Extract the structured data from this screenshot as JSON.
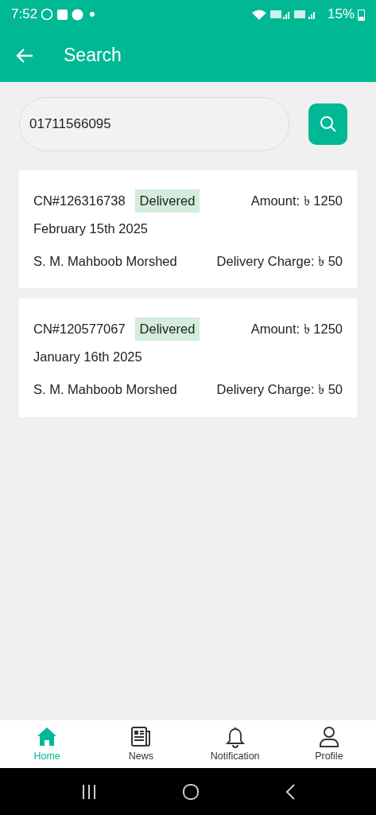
{
  "status_bar": {
    "time": "7:52",
    "battery": "15%"
  },
  "app_bar": {
    "title": "Search"
  },
  "search": {
    "value": "01711566095"
  },
  "results": [
    {
      "cn": "CN#126316738",
      "status": "Delivered",
      "amount": "Amount: ৳ 1250",
      "date": "February 15th 2025",
      "name": "S. M. Mahboob Morshed",
      "charge": "Delivery Charge: ৳ 50"
    },
    {
      "cn": "CN#120577067",
      "status": "Delivered",
      "amount": "Amount: ৳ 1250",
      "date": "January 16th 2025",
      "name": "S. M. Mahboob Morshed",
      "charge": "Delivery Charge: ৳ 50"
    }
  ],
  "bottom_nav": [
    {
      "kind": "home",
      "label": "Home",
      "selected": true
    },
    {
      "kind": "news",
      "label": "News",
      "selected": false
    },
    {
      "kind": "bell",
      "label": "Notification",
      "selected": false
    },
    {
      "kind": "person",
      "label": "Profile",
      "selected": false
    }
  ]
}
